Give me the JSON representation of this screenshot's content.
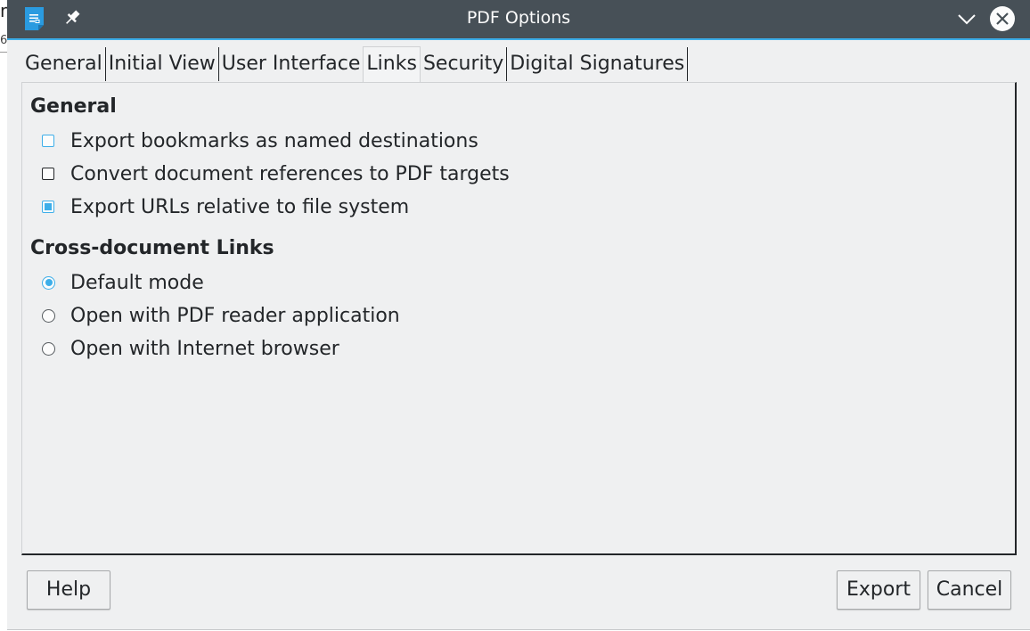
{
  "background": {
    "fragment_top": "n",
    "fragment_mid": "6"
  },
  "window": {
    "title": "PDF Options",
    "app_icon": "document-icon",
    "titlebar_color": "#475057",
    "accent_color": "#3daee9"
  },
  "tabs": [
    {
      "label": "General",
      "active": false
    },
    {
      "label": "Initial View",
      "active": false
    },
    {
      "label": "User Interface",
      "active": false
    },
    {
      "label": "Links",
      "active": true
    },
    {
      "label": "Security",
      "active": false
    },
    {
      "label": "Digital Signatures",
      "active": false
    }
  ],
  "general_section": {
    "heading": "General",
    "options": [
      {
        "label": "Export bookmarks as named destinations",
        "checked": false
      },
      {
        "label": "Convert document references to PDF targets",
        "checked": false
      },
      {
        "label": "Export URLs relative to file system",
        "checked": true
      }
    ]
  },
  "cross_doc_section": {
    "heading": "Cross-document Links",
    "options": [
      {
        "label": "Default mode",
        "selected": true
      },
      {
        "label": "Open with PDF reader application",
        "selected": false
      },
      {
        "label": "Open with Internet browser",
        "selected": false
      }
    ]
  },
  "buttons": {
    "help": "Help",
    "export": "Export",
    "cancel": "Cancel"
  }
}
